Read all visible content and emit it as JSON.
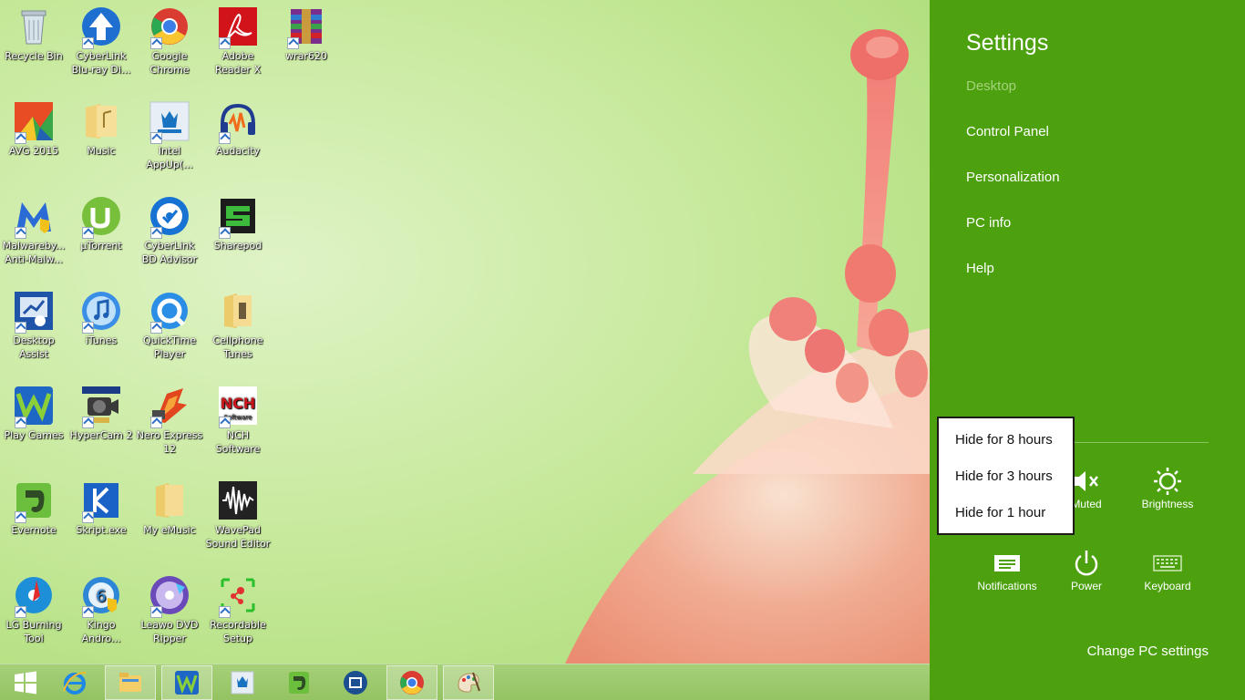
{
  "desktop": {
    "icons": [
      {
        "label": "Recycle Bin",
        "icon": "recycle-bin-icon"
      },
      {
        "label": "CyberLink Blu-ray Di...",
        "icon": "cyberlink-bluray-icon"
      },
      {
        "label": "Google Chrome",
        "icon": "chrome-icon"
      },
      {
        "label": "Adobe Reader X",
        "icon": "adobe-reader-icon"
      },
      {
        "label": "wrar620",
        "icon": "winrar-icon"
      },
      {
        "label": "AVG 2015",
        "icon": "avg-icon"
      },
      {
        "label": "Music",
        "icon": "folder-icon"
      },
      {
        "label": "Intel AppUp(...",
        "icon": "intel-appup-icon"
      },
      {
        "label": "Audacity",
        "icon": "audacity-icon"
      },
      {
        "label": "Malwareby... Anti-Malw...",
        "icon": "malwarebytes-icon"
      },
      {
        "label": "µTorrent",
        "icon": "utorrent-icon"
      },
      {
        "label": "CyberLink BD Advisor",
        "icon": "cyberlink-bd-advisor-icon"
      },
      {
        "label": "Sharepod",
        "icon": "sharepod-icon"
      },
      {
        "label": "Desktop Assist",
        "icon": "desktop-assist-icon"
      },
      {
        "label": "iTunes",
        "icon": "itunes-icon"
      },
      {
        "label": "QuickTime Player",
        "icon": "quicktime-icon"
      },
      {
        "label": "Cellphone Tunes",
        "icon": "folder-icon"
      },
      {
        "label": "Play Games",
        "icon": "play-games-icon"
      },
      {
        "label": "HyperCam 2",
        "icon": "hypercam-icon"
      },
      {
        "label": "Nero Express 12",
        "icon": "nero-icon"
      },
      {
        "label": "NCH Software",
        "icon": "nch-icon"
      },
      {
        "label": "Evernote",
        "icon": "evernote-icon"
      },
      {
        "label": "Skript.exe",
        "icon": "skript-icon"
      },
      {
        "label": "My eMusic",
        "icon": "folder-icon"
      },
      {
        "label": "WavePad Sound Editor",
        "icon": "wavepad-icon"
      },
      {
        "label": "LG Burning Tool",
        "icon": "lg-burning-icon"
      },
      {
        "label": "Kingo Andro...",
        "icon": "kingo-icon"
      },
      {
        "label": "Leawo DVD Ripper",
        "icon": "leawo-icon"
      },
      {
        "label": "Recordable Setup",
        "icon": "recordable-setup-icon"
      }
    ]
  },
  "taskbar": {
    "items": [
      "start-icon",
      "internet-explorer-icon",
      "file-explorer-icon",
      "play-games-icon",
      "intel-appup-icon",
      "evernote-icon",
      "movie-maker-icon",
      "chrome-icon",
      "paint-icon"
    ]
  },
  "settings": {
    "title": "Settings",
    "links": [
      "Desktop",
      "Control Panel",
      "Personalization",
      "PC info",
      "Help"
    ],
    "tiles": {
      "muted": "Muted",
      "brightness": "Brightness",
      "notifications": "Notifications",
      "power": "Power",
      "keyboard": "Keyboard"
    },
    "change_pc_settings": "Change PC settings",
    "accent": "#4da10f"
  },
  "popup": {
    "items": [
      "Hide for 8 hours",
      "Hide for 3 hours",
      "Hide for 1 hour"
    ]
  }
}
